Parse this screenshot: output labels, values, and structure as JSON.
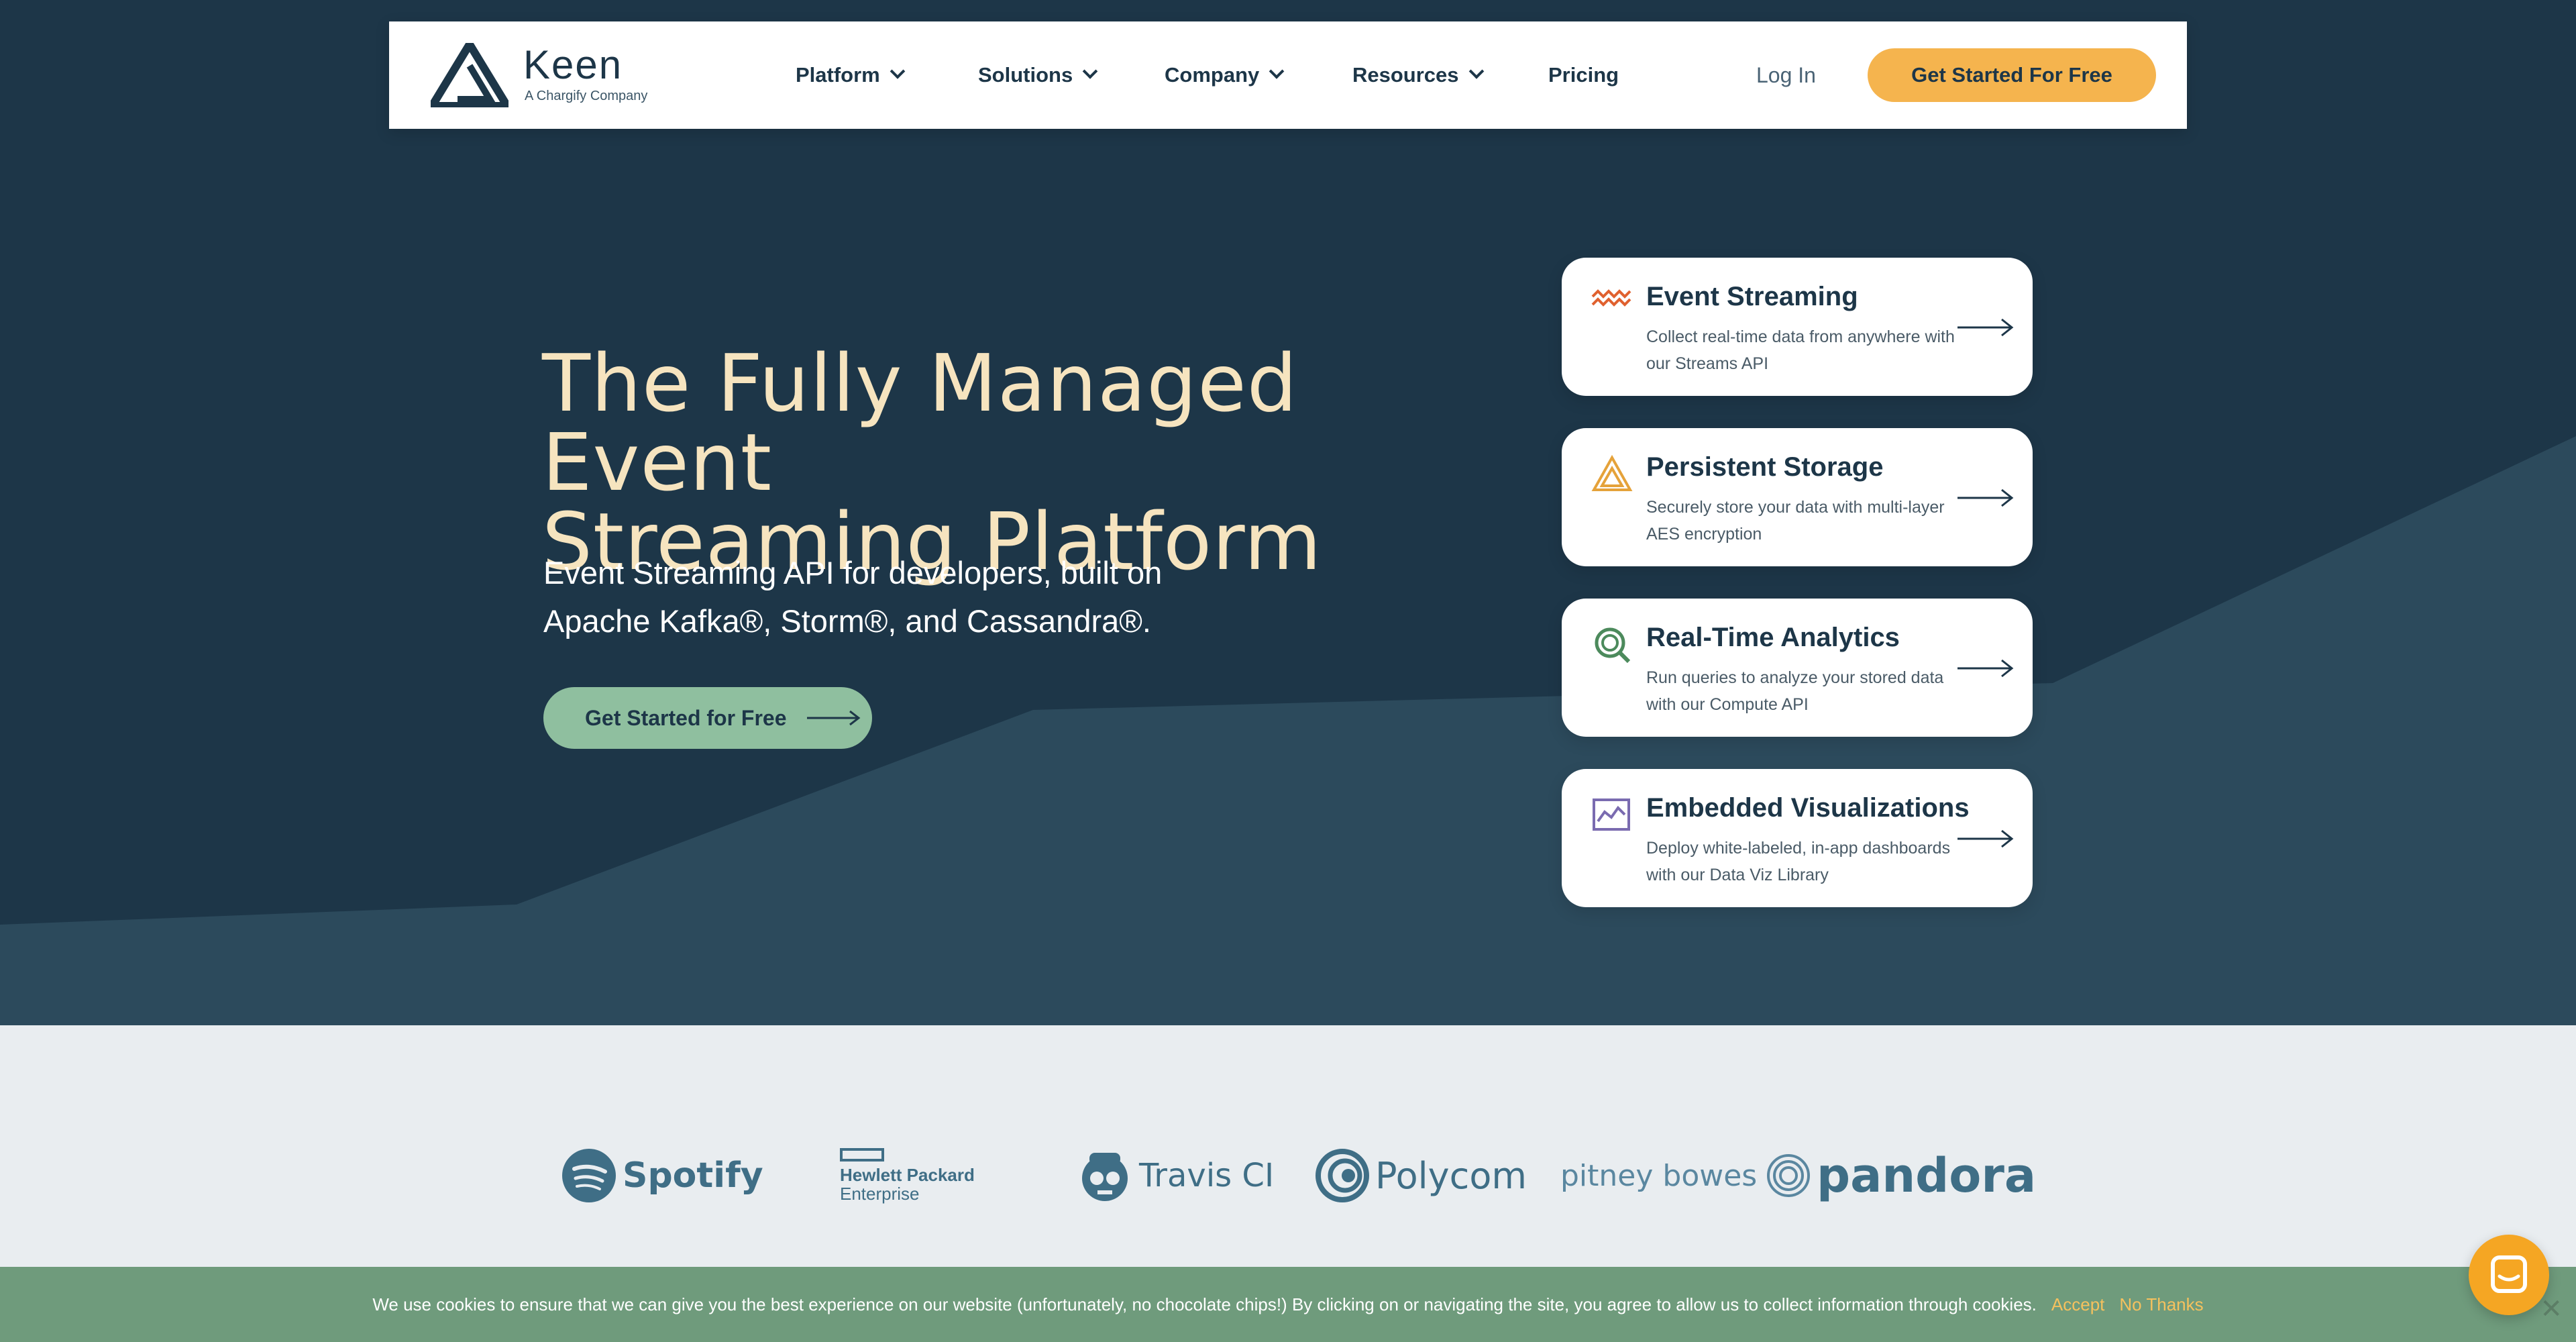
{
  "nav": {
    "logo_name": "Keen",
    "logo_sub": "A Chargify Company",
    "items": [
      {
        "label": "Platform",
        "dropdown": true
      },
      {
        "label": "Solutions",
        "dropdown": true
      },
      {
        "label": "Company",
        "dropdown": true
      },
      {
        "label": "Resources",
        "dropdown": true
      },
      {
        "label": "Pricing",
        "dropdown": false
      }
    ],
    "login": "Log In",
    "cta": "Get Started For Free"
  },
  "hero": {
    "title_line1": "The Fully Managed Event",
    "title_line2": "Streaming Platform",
    "sub_line1": "Event Streaming API for developers, built on",
    "sub_line2": "Apache Kafka®, Storm®, and Cassandra®.",
    "cta": "Get Started for Free"
  },
  "cards": [
    {
      "title": "Event Streaming",
      "desc": "Collect real-time data from anywhere with our Streams API",
      "icon": "wave-icon",
      "color": "#e0612f"
    },
    {
      "title": "Persistent Storage",
      "desc": "Securely store your data with multi-layer AES encryption",
      "icon": "triangle-icon",
      "color": "#e5a23a"
    },
    {
      "title": "Real-Time Analytics",
      "desc": "Run queries to analyze your stored data with our Compute API",
      "icon": "magnifier-icon",
      "color": "#4c8a5c"
    },
    {
      "title": "Embedded Visualizations",
      "desc": "Deploy white-labeled, in-app dashboards with our Data Viz Library",
      "icon": "chart-icon",
      "color": "#7a6bb0"
    }
  ],
  "clients": {
    "spotify": "Spotify",
    "hpe_line1": "Hewlett Packard",
    "hpe_line2": "Enterprise",
    "travis": "Travis CI",
    "polycom": "Polycom",
    "pitney": "pitney bowes",
    "pandora": "pandora"
  },
  "cookie": {
    "text": "We use cookies to ensure that we can give you the best experience on our website (unfortunately, no chocolate chips!) By clicking on or navigating the site, you agree to allow us to collect information through cookies.",
    "accept": "Accept",
    "decline": "No Thanks",
    "close": "✕"
  },
  "colors": {
    "hero_bg": "#1d3648",
    "hero_shape": "#2c4a5c",
    "accent": "#f5b44e",
    "hero_cta": "#8fbf9f",
    "cookie_bg": "#6f9b7c",
    "chat": "#f5a623"
  }
}
